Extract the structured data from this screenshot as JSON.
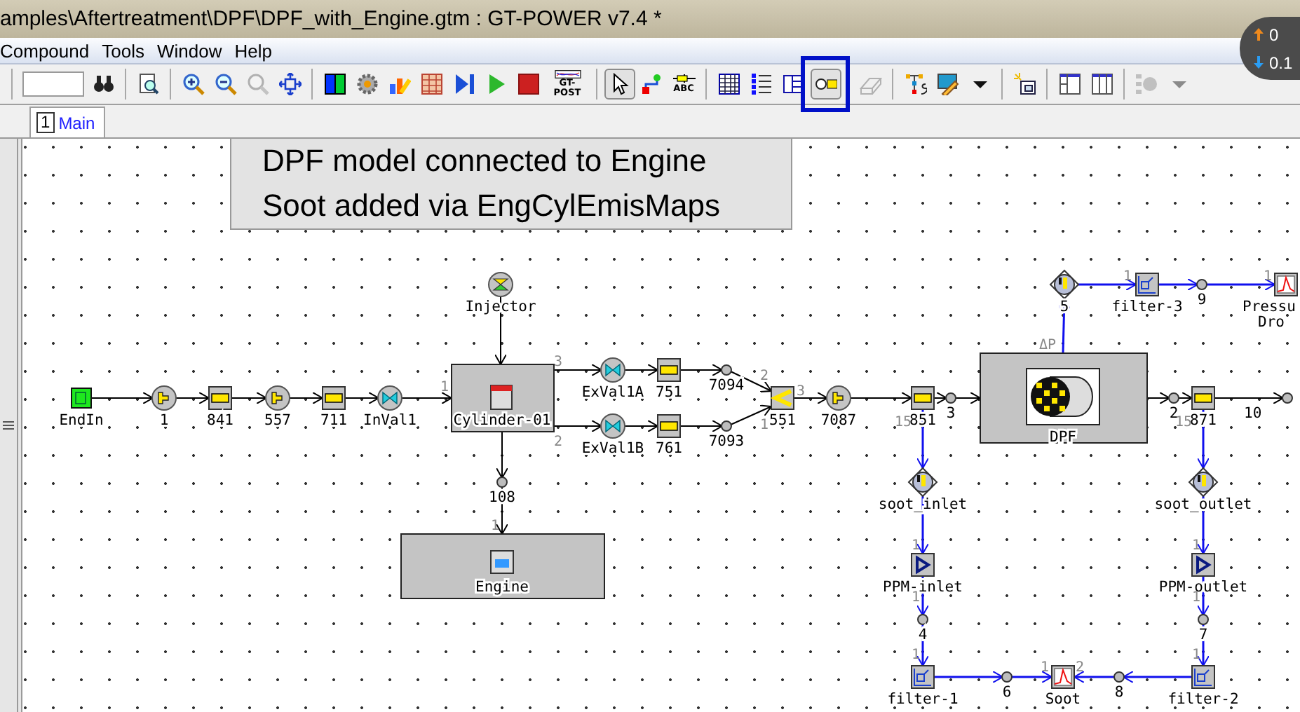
{
  "window": {
    "title": "amples\\Aftertreatment\\DPF\\DPF_with_Engine.gtm : GT-POWER v7.4 *"
  },
  "menu": [
    "Compound",
    "Tools",
    "Window",
    "Help"
  ],
  "toolbar": {
    "groups": [
      [
        {
          "kind": "binoculars",
          "pressed": false,
          "disabled": false
        }
      ],
      [
        {
          "kind": "properties",
          "pressed": false,
          "disabled": false
        }
      ],
      [
        {
          "kind": "zoom-in",
          "pressed": false,
          "disabled": false
        },
        {
          "kind": "zoom-out",
          "pressed": false,
          "disabled": false
        },
        {
          "kind": "zoom-reset",
          "pressed": false,
          "disabled": true
        },
        {
          "kind": "fit",
          "pressed": false,
          "disabled": false
        }
      ],
      [
        {
          "kind": "colors",
          "pressed": false,
          "disabled": false
        },
        {
          "kind": "gear",
          "pressed": false,
          "disabled": false
        },
        {
          "kind": "chart",
          "pressed": false,
          "disabled": false
        },
        {
          "kind": "table",
          "pressed": false,
          "disabled": false
        },
        {
          "kind": "skip",
          "pressed": false,
          "disabled": false
        },
        {
          "kind": "play",
          "pressed": false,
          "disabled": false
        },
        {
          "kind": "stop",
          "pressed": false,
          "disabled": false
        },
        {
          "kind": "post",
          "label": "GT-POST",
          "pressed": false,
          "disabled": false
        }
      ],
      [
        {
          "kind": "pointer",
          "pressed": true,
          "disabled": false
        },
        {
          "kind": "link",
          "pressed": false,
          "disabled": false
        },
        {
          "kind": "abc",
          "label": "ABC",
          "pressed": false,
          "disabled": false
        }
      ],
      [
        {
          "kind": "grid",
          "pressed": false,
          "disabled": false
        },
        {
          "kind": "list",
          "pressed": false,
          "disabled": false
        },
        {
          "kind": "tree",
          "pressed": false,
          "disabled": false
        },
        {
          "kind": "part",
          "pressed": true,
          "disabled": false,
          "highlighted": true
        }
      ],
      [
        {
          "kind": "eraser",
          "pressed": false,
          "disabled": true
        }
      ],
      [
        {
          "kind": "template",
          "pressed": false,
          "disabled": false
        },
        {
          "kind": "edit",
          "pressed": false,
          "disabled": false
        },
        {
          "kind": "dropdown",
          "pressed": false,
          "disabled": false
        }
      ],
      [
        {
          "kind": "add-part",
          "pressed": false,
          "disabled": false
        }
      ],
      [
        {
          "kind": "layout-a",
          "pressed": false,
          "disabled": false
        },
        {
          "kind": "layout-b",
          "pressed": false,
          "disabled": false
        }
      ],
      [
        {
          "kind": "nodes",
          "pressed": false,
          "disabled": true
        },
        {
          "kind": "dropdown",
          "pressed": false,
          "disabled": true
        }
      ]
    ]
  },
  "tabs": [
    {
      "number": "1",
      "label": "Main",
      "selected": true
    }
  ],
  "note": {
    "lines": [
      "DPF model connected to Engine",
      "Soot added via EngCylEmisMaps"
    ]
  },
  "net_widget": {
    "up": "0",
    "down": "0.1"
  },
  "diagram": {
    "nodes": [
      {
        "kind": "environment",
        "label": "EndIn"
      },
      {
        "kind": "orifice",
        "label": "1"
      },
      {
        "kind": "pipe",
        "label": "841"
      },
      {
        "kind": "orifice",
        "label": "557"
      },
      {
        "kind": "pipe",
        "label": "711"
      },
      {
        "kind": "valve",
        "label": "InVal1"
      },
      {
        "kind": "injector",
        "label": "Injector"
      },
      {
        "kind": "cylinder",
        "label": "Cylinder-01"
      },
      {
        "kind": "valve",
        "label": "ExVal1A"
      },
      {
        "kind": "valve",
        "label": "ExVal1B"
      },
      {
        "kind": "pipe",
        "label": "751"
      },
      {
        "kind": "pipe",
        "label": "761"
      },
      {
        "kind": "junction",
        "label": "7094"
      },
      {
        "kind": "junction",
        "label": "7093"
      },
      {
        "kind": "flowsplit",
        "label": "551"
      },
      {
        "kind": "orifice",
        "label": "7087"
      },
      {
        "kind": "pipe",
        "label": "851"
      },
      {
        "kind": "junction",
        "label": "3"
      },
      {
        "kind": "dpf",
        "label": "DPF"
      },
      {
        "kind": "junction",
        "label": "2"
      },
      {
        "kind": "pipe",
        "label": "871"
      },
      {
        "kind": "junction",
        "label": "10"
      },
      {
        "kind": "junction",
        "label": "108"
      },
      {
        "kind": "engine",
        "label": "Engine"
      },
      {
        "kind": "sensor",
        "label": "5"
      },
      {
        "kind": "filter",
        "label": "filter-3"
      },
      {
        "kind": "junction",
        "label": "9"
      },
      {
        "kind": "monitor",
        "label": "Pressu",
        "label_2": "Dro"
      },
      {
        "kind": "sensor",
        "label": "soot_inlet"
      },
      {
        "kind": "sensor",
        "label": "soot_outlet"
      },
      {
        "kind": "gain",
        "label": "PPM-inlet"
      },
      {
        "kind": "gain",
        "label": "PPM-outlet"
      },
      {
        "kind": "junction",
        "label": "4"
      },
      {
        "kind": "junction",
        "label": "7"
      },
      {
        "kind": "filter",
        "label": "filter-1"
      },
      {
        "kind": "junction",
        "label": "6"
      },
      {
        "kind": "monitor",
        "label": "Soot"
      },
      {
        "kind": "junction",
        "label": "8"
      },
      {
        "kind": "filter",
        "label": "filter-2"
      }
    ],
    "port_labels": [
      "1",
      "3",
      "2",
      "1",
      "2",
      "3",
      "1",
      "15",
      "ΔP",
      "1",
      "1",
      "15",
      "1",
      "1",
      "1",
      "1",
      "2",
      "1",
      "1",
      "1"
    ]
  }
}
